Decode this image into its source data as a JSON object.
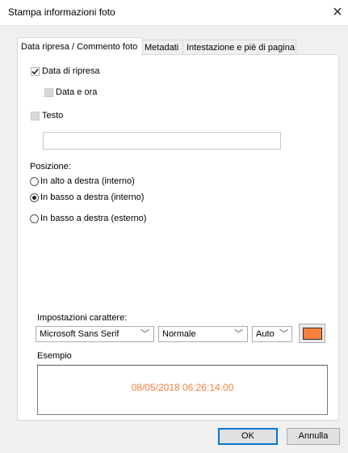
{
  "window": {
    "title": "Stampa informazioni foto",
    "close_glyph": "✕"
  },
  "tabs": [
    {
      "label": "Data ripresa / Commento foto",
      "active": true
    },
    {
      "label": "Metadati",
      "active": false
    },
    {
      "label": "Intestazione e piè di pagina",
      "active": false
    }
  ],
  "options": {
    "data_ripresa": {
      "label": "Data di ripresa",
      "checked": true
    },
    "data_e_ora": {
      "label": "Data e ora",
      "checked": false,
      "disabled": true
    },
    "testo": {
      "label": "Testo",
      "checked": false,
      "disabled": true
    },
    "testo_value": ""
  },
  "posizione": {
    "label": "Posizione:",
    "radios": [
      {
        "label": "In alto a destra (interno)",
        "selected": false
      },
      {
        "label": "In basso a destra (interno)",
        "selected": true
      },
      {
        "label": "In basso a destra (esterno)",
        "selected": false
      }
    ]
  },
  "font_settings": {
    "label": "Impostazioni carattere:",
    "font_family": "Microsoft Sans Serif",
    "font_style": "Normale",
    "font_size": "Auto",
    "color": "#f7803c"
  },
  "example": {
    "label": "Esempio",
    "text": "08/05/2018 06:26:14.00",
    "color": "#f7803c"
  },
  "buttons": {
    "ok": "OK",
    "cancel": "Annulla"
  },
  "icons": {
    "checkmark": "check-icon",
    "dropdown": "chevron-down-icon",
    "close": "close-icon"
  }
}
